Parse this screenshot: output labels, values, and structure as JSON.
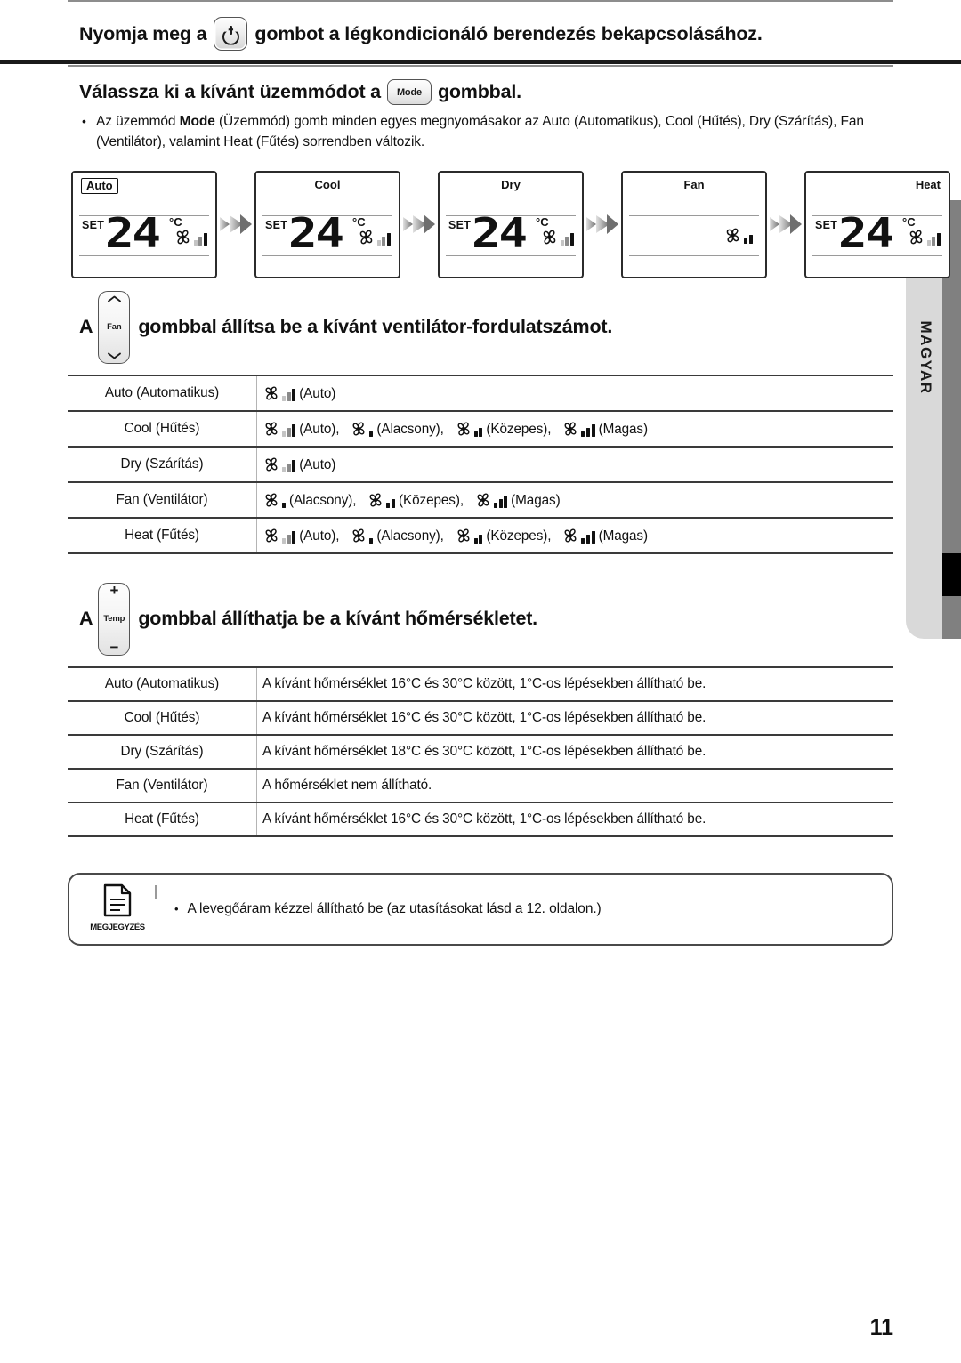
{
  "document": {
    "language_tab": "MAGYAR",
    "page_number": "11"
  },
  "sections": {
    "power": {
      "text_before": "Nyomja meg a",
      "button_icon": "power-icon",
      "text_after": "gombot a légkondicionáló berendezés bekapcsolásához."
    },
    "mode": {
      "text_before": "Válassza ki a kívánt üzemmódot a",
      "button_label": "Mode",
      "text_after": "gombbal.",
      "bullet": {
        "marker": "•",
        "pre": "Az üzemmód ",
        "bold": "Mode",
        "post": " (Üzemmód) gomb minden egyes megnyomásakor az Auto (Automatikus), Cool (Hűtés), Dry (Szárítás), Fan (Ventilátor), valamint Heat (Fűtés) sorrendben változik."
      },
      "panels": [
        {
          "label": "Auto",
          "label_pos": "left",
          "boxed": true,
          "set": "SET",
          "temp": "24",
          "unit": "°C",
          "fan_bars": "auto"
        },
        {
          "label": "Cool",
          "label_pos": "center",
          "boxed": false,
          "set": "SET",
          "temp": "24",
          "unit": "°C",
          "fan_bars": "auto"
        },
        {
          "label": "Dry",
          "label_pos": "center",
          "boxed": false,
          "set": "SET",
          "temp": "24",
          "unit": "°C",
          "fan_bars": "auto"
        },
        {
          "label": "Fan",
          "label_pos": "center",
          "boxed": false,
          "set": "",
          "temp": "",
          "unit": "",
          "fan_bars": "medium"
        },
        {
          "label": "Heat",
          "label_pos": "right",
          "boxed": false,
          "set": "SET",
          "temp": "24",
          "unit": "°C",
          "fan_bars": "auto"
        }
      ]
    },
    "fan_speed": {
      "text_before": "A",
      "button_label": "Fan",
      "text_after": "gombbal állítsa be a kívánt ventilátor-fordulatszámot.",
      "rows": [
        {
          "mode": "Auto (Automatikus)",
          "speeds": [
            {
              "bars": "auto",
              "name": "(Auto)"
            }
          ]
        },
        {
          "mode": "Cool (Hűtés)",
          "speeds": [
            {
              "bars": "auto",
              "name": "(Auto),"
            },
            {
              "bars": "low",
              "name": "(Alacsony),"
            },
            {
              "bars": "medium",
              "name": "(Közepes),"
            },
            {
              "bars": "high",
              "name": "(Magas)"
            }
          ]
        },
        {
          "mode": "Dry (Szárítás)",
          "speeds": [
            {
              "bars": "auto",
              "name": "(Auto)"
            }
          ]
        },
        {
          "mode": "Fan (Ventilátor)",
          "speeds": [
            {
              "bars": "low",
              "name": "(Alacsony),"
            },
            {
              "bars": "medium",
              "name": "(Közepes),"
            },
            {
              "bars": "high",
              "name": "(Magas)"
            }
          ]
        },
        {
          "mode": "Heat (Fűtés)",
          "speeds": [
            {
              "bars": "auto",
              "name": "(Auto),"
            },
            {
              "bars": "low",
              "name": "(Alacsony),"
            },
            {
              "bars": "medium",
              "name": "(Közepes),"
            },
            {
              "bars": "high",
              "name": "(Magas)"
            }
          ]
        }
      ]
    },
    "temperature": {
      "text_before": "A",
      "button_label": "Temp",
      "button_plus": "+",
      "button_minus": "−",
      "text_after": "gombbal állíthatja be a kívánt hőmérsékletet.",
      "rows": [
        {
          "mode": "Auto (Automatikus)",
          "value": "A kívánt hőmérséklet 16°C és 30°C között, 1°C-os lépésekben állítható be."
        },
        {
          "mode": "Cool (Hűtés)",
          "value": "A kívánt hőmérséklet 16°C és 30°C között, 1°C-os lépésekben állítható be."
        },
        {
          "mode": "Dry (Szárítás)",
          "value": "A kívánt hőmérséklet 18°C és 30°C között, 1°C-os lépésekben állítható be."
        },
        {
          "mode": "Fan (Ventilátor)",
          "value": "A hőmérséklet nem állítható."
        },
        {
          "mode": "Heat (Fűtés)",
          "value": "A kívánt hőmérséklet 16°C és 30°C között, 1°C-os lépésekben állítható be."
        }
      ]
    },
    "note": {
      "caption": "MEGJEGYZÉS",
      "marker": "•",
      "text": "A levegőáram kézzel állítható be (az utasításokat lásd a 12. oldalon.)"
    }
  },
  "colors": {
    "rule": "#1a1a1a",
    "table_border": "#b4b4b4",
    "tab_bg": "#d9d9d9",
    "strip_bg": "#808080",
    "strip_mark": "#000000",
    "bar_light": "#c4c4c4",
    "bar_mid": "#8a8a8a",
    "bar_dark": "#111111"
  }
}
